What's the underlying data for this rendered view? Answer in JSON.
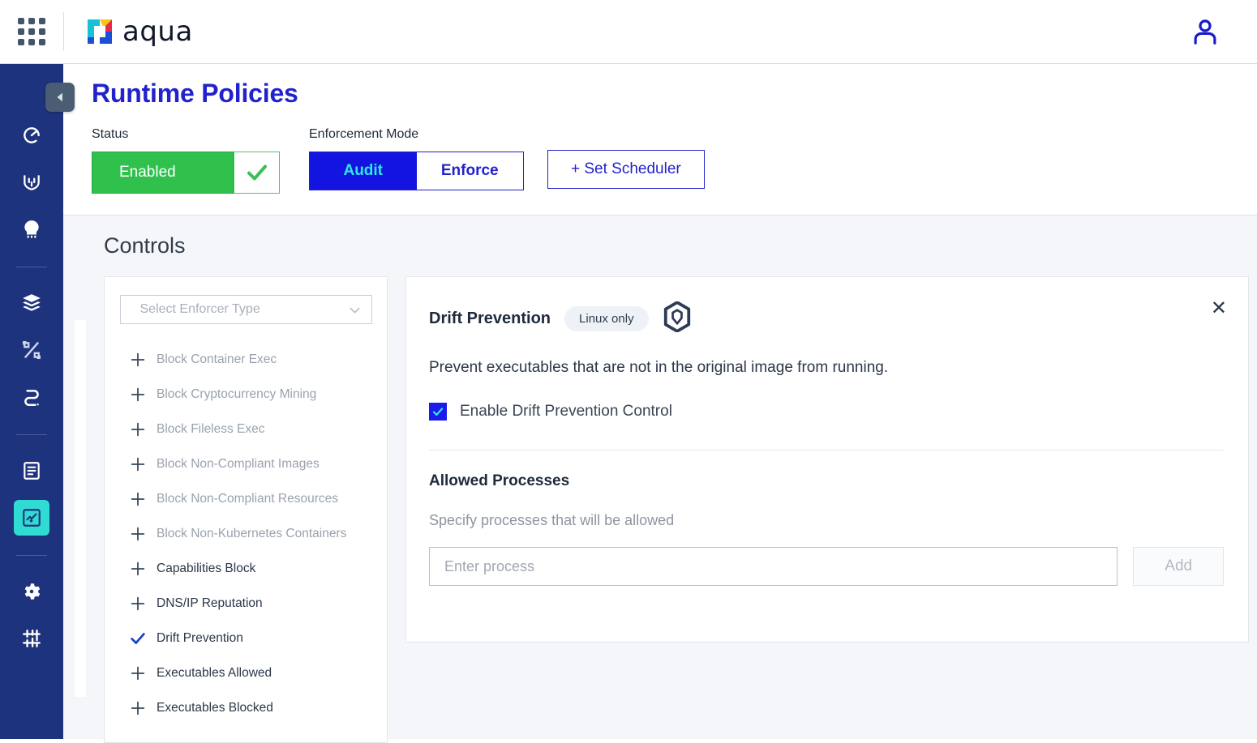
{
  "topbar": {
    "grid_menu_icon": "grid-apps-icon",
    "brand_name": "aqua",
    "brand_logo_icon": "aqua-pinwheel-logo",
    "user_icon": "user-account-icon"
  },
  "sidebar": {
    "collapse_icon": "chevron-left-icon",
    "items": [
      {
        "icon": "dashboard-gauge-icon",
        "active": false
      },
      {
        "icon": "shield-vulnerability-icon",
        "active": false
      },
      {
        "icon": "skull-threat-icon",
        "active": false
      },
      {
        "separator": true
      },
      {
        "icon": "layers-stack-icon",
        "active": false
      },
      {
        "icon": "percent-compliance-icon",
        "active": false
      },
      {
        "icon": "supply-chain-icon",
        "active": false
      },
      {
        "separator": true
      },
      {
        "icon": "document-report-icon",
        "active": false
      },
      {
        "icon": "runtime-policy-icon",
        "active": true
      },
      {
        "separator": true
      },
      {
        "icon": "gear-settings-icon",
        "active": false
      },
      {
        "icon": "sliders-integrations-icon",
        "active": false
      }
    ]
  },
  "page": {
    "title": "Runtime Policies",
    "status": {
      "label": "Status",
      "value": "Enabled",
      "check_icon": "check-icon",
      "on_color": "#2fc14c"
    },
    "enforcement": {
      "label": "Enforcement Mode",
      "options": [
        "Audit",
        "Enforce"
      ],
      "selected": "Audit",
      "selected_bg": "#1414e0",
      "selected_fg": "#2ee8e8"
    },
    "scheduler_button": "+ Set Scheduler"
  },
  "controls": {
    "heading": "Controls",
    "enforcer_select": {
      "placeholder": "Select Enforcer Type",
      "chevron_icon": "chevron-down-icon"
    },
    "items": [
      {
        "label": "Block Container Exec",
        "icon": "plus-icon",
        "selected": false,
        "dim": true
      },
      {
        "label": "Block Cryptocurrency Mining",
        "icon": "plus-icon",
        "selected": false,
        "dim": true
      },
      {
        "label": "Block Fileless Exec",
        "icon": "plus-icon",
        "selected": false,
        "dim": true
      },
      {
        "label": "Block Non-Compliant Images",
        "icon": "plus-icon",
        "selected": false,
        "dim": true
      },
      {
        "label": "Block Non-Compliant Resources",
        "icon": "plus-icon",
        "selected": false,
        "dim": true
      },
      {
        "label": "Block Non-Kubernetes Containers",
        "icon": "plus-icon",
        "selected": false,
        "dim": true
      },
      {
        "label": "Capabilities Block",
        "icon": "plus-icon",
        "selected": false,
        "dim": false
      },
      {
        "label": "DNS/IP Reputation",
        "icon": "plus-icon",
        "selected": false,
        "dim": false
      },
      {
        "label": "Drift Prevention",
        "icon": "check-icon",
        "selected": true,
        "dim": false
      },
      {
        "label": "Executables Allowed",
        "icon": "plus-icon",
        "selected": false,
        "dim": false
      },
      {
        "label": "Executables Blocked",
        "icon": "plus-icon",
        "selected": false,
        "dim": false
      }
    ]
  },
  "detail": {
    "title": "Drift Prevention",
    "os_badge": "Linux only",
    "badge_icon": "hex-shield-icon",
    "close_icon": "close-x-icon",
    "description": "Prevent executables that are not in the original image from running.",
    "enable_checkbox": {
      "label": "Enable Drift Prevention Control",
      "checked": true,
      "icon": "checkbox-checked-icon"
    },
    "allowed_processes": {
      "title": "Allowed Processes",
      "hint": "Specify processes that will be allowed",
      "input_placeholder": "Enter process",
      "input_value": "",
      "add_button": "Add"
    }
  }
}
